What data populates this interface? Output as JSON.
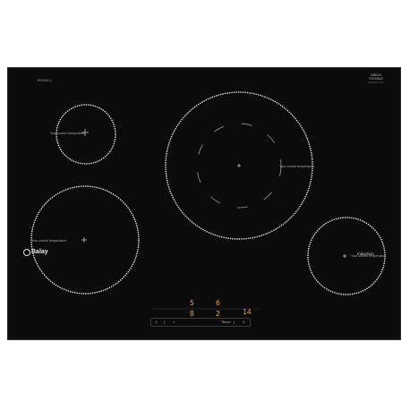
{
  "hob": {
    "brand": "Balay",
    "model": "3EB865LQ",
    "badge_line1": "SINGLE",
    "badge_line2": "FLEXIBLE",
    "badge_sub": "INDUCCION",
    "mode_label": "Induction",
    "zones": [
      {
        "id": "front-left-small",
        "label": "Your control temperature"
      },
      {
        "id": "back-left-large",
        "label": "Your control temperature"
      },
      {
        "id": "center-xl",
        "label": "Your control temperature"
      },
      {
        "id": "right-small",
        "label": "Your control temperature"
      }
    ],
    "display": {
      "zone_a_value": "5",
      "zone_b_value": "6",
      "zone_c_value": "8",
      "zone_d_value": "2",
      "timer_value": "14"
    },
    "controls": [
      "◇",
      "|",
      "<",
      "Timer",
      "|",
      "◇"
    ]
  },
  "colors": {
    "glass": "#0b0b0b",
    "zone_ring": "#d8d8d8",
    "display": "#f0a030"
  }
}
